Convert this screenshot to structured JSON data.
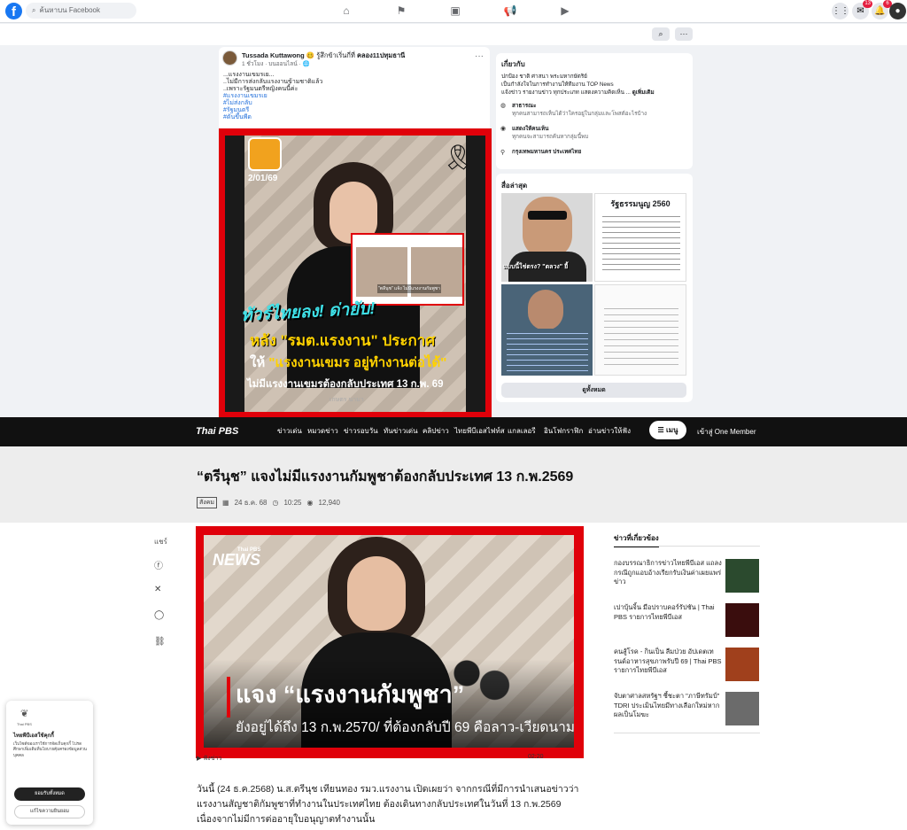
{
  "facebook": {
    "search_placeholder": "ค้นหาบน Facebook",
    "notif_badges": [
      "13",
      "6"
    ],
    "topbar_search_icon": "search-icon",
    "more_icon": "more-icon"
  },
  "post": {
    "author": "Tussada Kuttawong",
    "feeling": "🥴 รู้สึกข้าเริ่นกี่ที่",
    "location": "คลอง11ปทุมธานี",
    "meta": "1 ชั่วโมง · บนออนไลน์ · 🌐",
    "lines": [
      "...แรงงานเขมรเย...",
      "..ไม่มีการส่งกลับแรงงานข้ามชาติแล้ว",
      "..เพราะรัฐมนตรีหญิงคนนี้ค่ะ"
    ],
    "hashtags": [
      "#แรงงานเขมรเย",
      "#ไม่ส่งกลับ",
      "#รัฐมนตรี",
      "#ดันขึ้นพีด"
    ],
    "image": {
      "date": "2/01/69",
      "inset_caption": "\"ตลีนุช\" แจ้ง ไม่มีแรงงานกัมพูชา",
      "h1": "ทัวร์ไทยลง! ด่ายับ!",
      "h2": "หลัง \"รมต.แรงงาน\" ประกาศ",
      "h3a": "ให้ ",
      "h3b": "\"แรงงานเขมร อยู่ทำงานต่อได้\"",
      "h4": "ไม่มีแรงงานเขมรต้องกลับประเทศ 13 ก.พ. 69",
      "watermark": "เกษตร นามา"
    }
  },
  "about": {
    "heading": "เกี่ยวกับ",
    "desc1": "ปกป้อง ชาติ ศาสนา พระมหากษัตริย์",
    "desc2": "เป็นกำลังใจในการทำงานให้ทีมงาน TOP News",
    "desc3": "แจ้งข่าว รายงานข่าว ทุกประเภท แสดงความคิดเห็น ... ",
    "see_more": "ดูเพิ่มเติม",
    "public_title": "สาธารณะ",
    "public_sub": "ทุกคนสามารถเห็นได้ว่าใครอยู่ในกลุ่มและโพสต์อะไรบ้าง",
    "visible_title": "แสดงให้คนเห็น",
    "visible_sub": "ทุกคนจะสามารถค้นหากลุ่มนี้พบ",
    "location": "กรุงเทพมหานคร ประเทศไทย"
  },
  "media": {
    "heading": "สื่อล่าสุด",
    "m1_caption": "แบบนี้ใช่ตรง? \"ตลวง\" ยี้",
    "m2_title": "รัฐธรรมนูญ 2560",
    "see_all": "ดูทั้งหมด"
  },
  "thaipbs": {
    "logo": "Thai PBS",
    "nav": [
      "ข่าวเด่น",
      "หมวดข่าว",
      "ข่าวรอบวัน",
      "ทันข่าวเด่น",
      "คลิปข่าว",
      "ไทยพีบีเอสไฟท์ส",
      "แกลเลอรี",
      "อินโฟกราฟิก",
      "อ่านข่าวให้ฟัง"
    ],
    "menu": "เมนู",
    "member": "เข้าสู่ One Member",
    "title": "“ตรีนุช” แจงไม่มีแรงงานกัมพูชาต้องกลับประเทศ 13 ก.พ.2569",
    "tag": "สังคม",
    "date": "24 ธ.ค. 68",
    "time": "10:25",
    "views": "12,940",
    "share_label": "แชร์",
    "hero": {
      "badge_small": "Thai PBS",
      "badge": "NEWS",
      "h1": "แจง “แรงงานกัมพูชา”",
      "h2": "ยังอยู่ได้ถึง 13 ก.พ.2570/ ที่ต้องกลับปี 69 คือลาว-เวียดนาม"
    },
    "audio_label": "ฟังข่าว",
    "audio_time": "02:20",
    "body": "วันนี้ (24 ธ.ค.2568) น.ส.ตรีนุช เทียนทอง รมว.แรงงาน เปิดเผยว่า จากกรณีที่มีการนำเสนอข่าวว่า แรงงานสัญชาติกัมพูชาที่ทำงานในประเทศไทย ต้องเดินทางกลับประเทศในวันที่ 13 ก.พ.2569 เนื่องจากไม่มีการต่ออายุใบอนุญาตทำงานนั้น",
    "related_heading": "ข่าวที่เกี่ยวข้อง",
    "related": [
      "กองบรรณาธิการข่าวไทยพีบีเอส แถลงกรณีถูกแอบอ้างเรียกรับเงินค่าเผยแพร่ข่าว",
      "เปาบุ้นจิ้น มือปราบคอร์รัปชัน | Thai PBS รายการไทยพีบีเอส",
      "คนสู้โรค - กินเป็น ลืมป่วย อัปเดตเทรนด์อาหารสุขภาพรับปี 69 | Thai PBS รายการไทยพีบีเอส",
      "จับตาศาลสหรัฐฯ ชี้ชะตา \"ภาษีทรัมป์\" TDRI ประเมินไทยมีทางเลือกใหม่หากผลเป็นโมฆะ"
    ],
    "related_thumb_text": [
      "พักงานตะ",
      "เปาบุ้นจิ้น",
      "กินเป็น ลืมป่วย",
      ""
    ]
  },
  "cookie": {
    "logo": "Thai PBS",
    "heading": "ไทยพีบีเอสใช้คุกกี้",
    "text": "เว็บไซต์ของเราใช้การจัดเก็บคุกกี้ โปรดศึกษาเพิ่มเติมที่นโยบายคุ้มครองข้อมูลส่วนบุคคล",
    "accept": "ยอมรับทั้งหมด",
    "settings": "แก้ไขความยินยอม"
  }
}
